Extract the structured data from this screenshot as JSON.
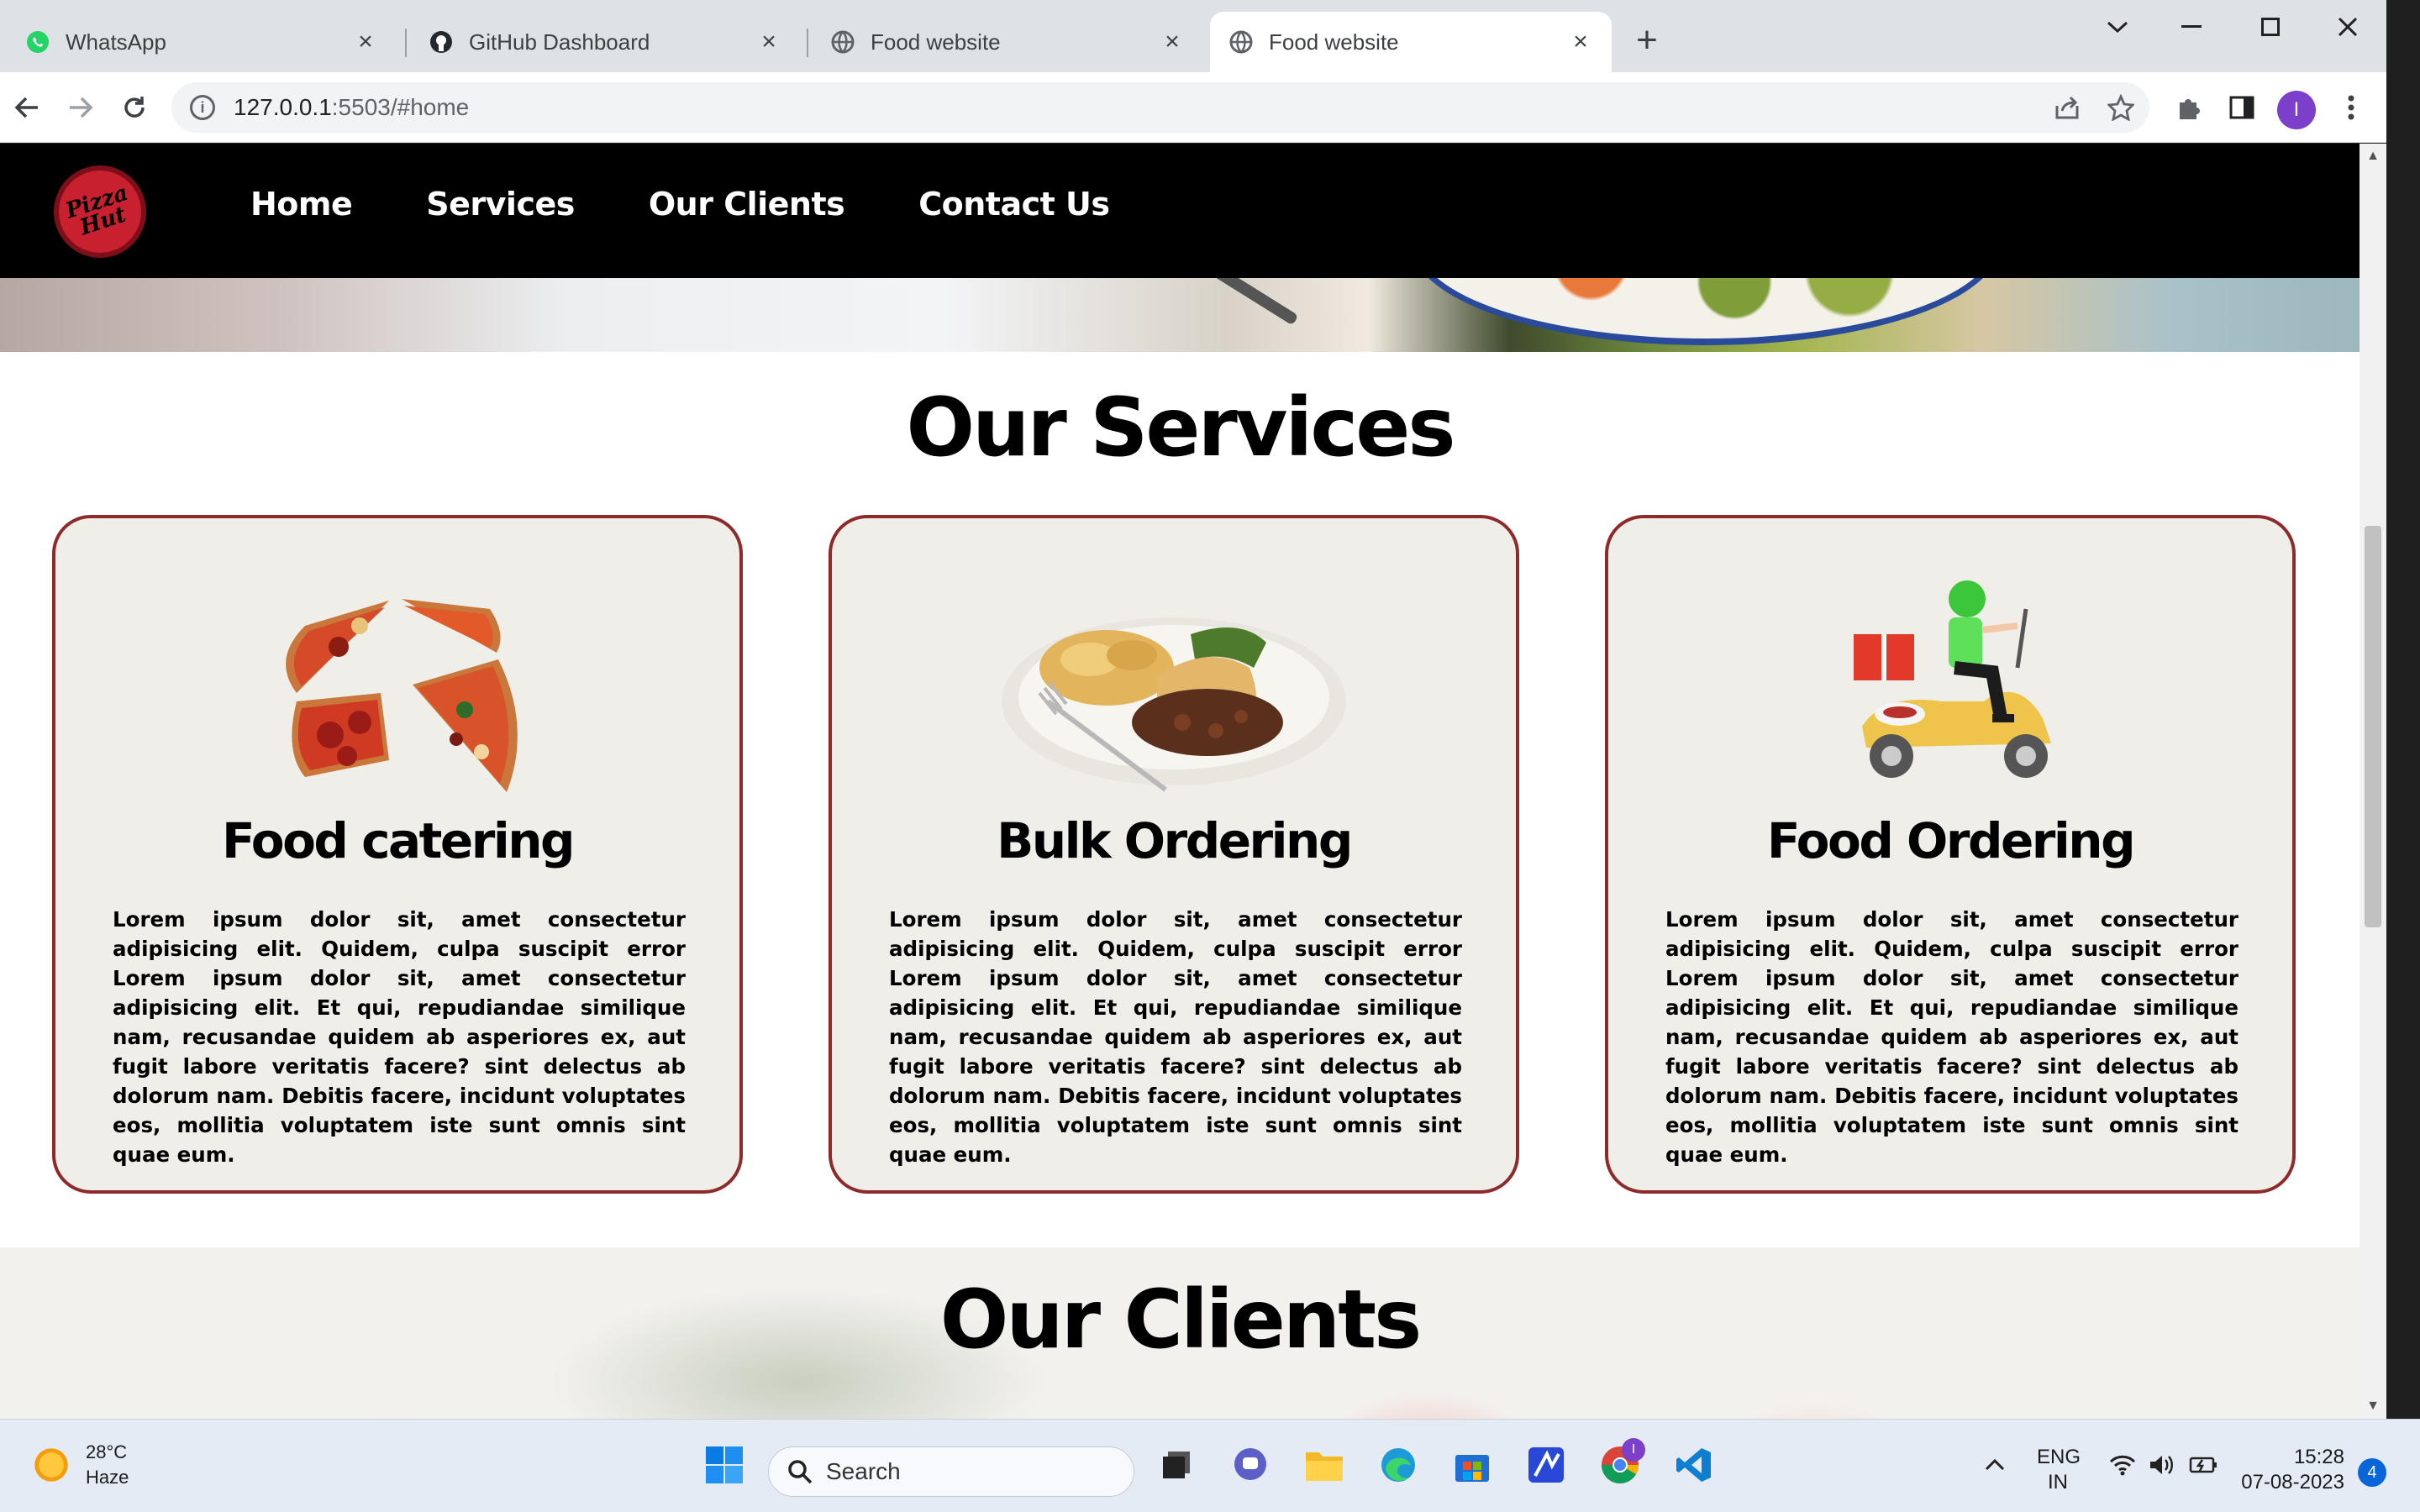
{
  "browser": {
    "tabs": [
      {
        "title": "WhatsApp",
        "icon": "whatsapp-icon"
      },
      {
        "title": "GitHub Dashboard",
        "icon": "github-icon"
      },
      {
        "title": "Food website",
        "icon": "globe-icon"
      },
      {
        "title": "Food website",
        "icon": "globe-icon",
        "active": true
      }
    ],
    "url_host": "127.0.0.1",
    "url_path": ":5503/#home",
    "profile_initial": "I"
  },
  "site": {
    "logo_text": "Pizza Hut",
    "nav": [
      "Home",
      "Services",
      "Our Clients",
      "Contact Us"
    ],
    "services_title": "Our Services",
    "cards": [
      {
        "title": "Food catering",
        "image": "pizza-slices-image",
        "text": "Lorem ipsum dolor sit, amet consectetur adipisicing elit. Quidem, culpa suscipit error Lorem ipsum dolor sit, amet consectetur adipisicing elit. Et qui, repudiandae similique nam, recusandae quidem ab asperiores ex, aut fugit labore veritatis facere? sint delectus ab dolorum nam. Debitis facere, incidunt voluptates eos, mollitia voluptatem iste sunt omnis sint quae eum."
      },
      {
        "title": "Bulk Ordering",
        "image": "meal-plate-image",
        "text": "Lorem ipsum dolor sit, amet consectetur adipisicing elit. Quidem, culpa suscipit error Lorem ipsum dolor sit, amet consectetur adipisicing elit. Et qui, repudiandae similique nam, recusandae quidem ab asperiores ex, aut fugit labore veritatis facere? sint delectus ab dolorum nam. Debitis facere, incidunt voluptates eos, mollitia voluptatem iste sunt omnis sint quae eum."
      },
      {
        "title": "Food Ordering",
        "image": "delivery-scooter-image",
        "text": "Lorem ipsum dolor sit, amet consectetur adipisicing elit. Quidem, culpa suscipit error Lorem ipsum dolor sit, amet consectetur adipisicing elit. Et qui, repudiandae similique nam, recusandae quidem ab asperiores ex, aut fugit labore veritatis facere? sint delectus ab dolorum nam. Debitis facere, incidunt voluptates eos, mollitia voluptatem iste sunt omnis sint quae eum."
      }
    ],
    "clients_title": "Our Clients"
  },
  "taskbar": {
    "temperature": "28°C",
    "condition": "Haze",
    "search_label": "Search",
    "lang_primary": "ENG",
    "lang_secondary": "IN",
    "time": "15:28",
    "date": "07-08-2023",
    "notifications": "4",
    "chrome_badge": "I"
  },
  "colors": {
    "card_border": "#8e2a2a",
    "card_bg": "#efeee9",
    "nav_bg": "#000000",
    "logo_red": "#c8202f"
  }
}
